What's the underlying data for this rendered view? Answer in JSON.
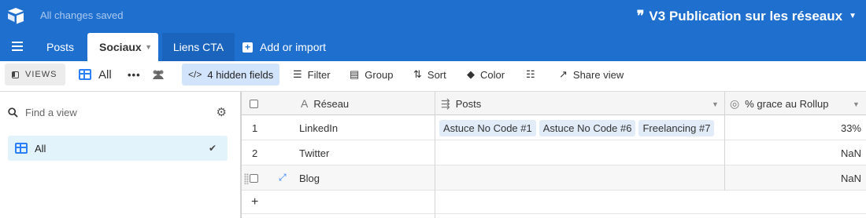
{
  "topbar": {
    "saved_status": "All changes saved",
    "base_name": "V3 Publication sur les réseaux",
    "quote_glyph": "❞",
    "caret_glyph": "▼",
    "color": "#1f6fcf"
  },
  "tabs": [
    {
      "label": "Posts"
    },
    {
      "label": "Sociaux",
      "active": true
    },
    {
      "label": "Liens CTA"
    },
    {
      "label": "Add or import"
    }
  ],
  "viewbar": {
    "views_label": "VIEWS",
    "current_view": "All",
    "hidden_fields": "4 hidden fields",
    "filter": "Filter",
    "group": "Group",
    "sort": "Sort",
    "color": "Color",
    "share_view": "Share view"
  },
  "sidebar": {
    "find_placeholder": "Find a view",
    "views": [
      {
        "label": "All",
        "selected": true
      }
    ]
  },
  "grid": {
    "columns": [
      {
        "label": "Réseau",
        "icon": "text-field-icon"
      },
      {
        "label": "Posts",
        "icon": "linked-record-icon"
      },
      {
        "label": "% grace au Rollup",
        "icon": "rollup-icon"
      }
    ],
    "rows": [
      {
        "num": "1",
        "reseau": "LinkedIn",
        "posts": [
          "Astuce No Code #1",
          "Astuce No Code #6",
          "Freelancing #7"
        ],
        "rollup": "33%"
      },
      {
        "num": "2",
        "reseau": "Twitter",
        "posts": [],
        "rollup": "NaN"
      },
      {
        "num": "",
        "reseau": "Blog",
        "posts": [],
        "rollup": "NaN"
      }
    ],
    "add_row_glyph": "+"
  }
}
